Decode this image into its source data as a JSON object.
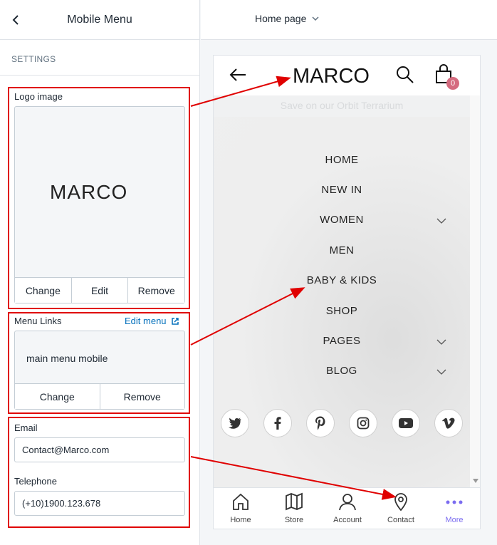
{
  "panel": {
    "title": "Mobile Menu",
    "settings_label": "SETTINGS"
  },
  "logo_section": {
    "label": "Logo image",
    "brand_text": "MARCO",
    "buttons": {
      "change": "Change",
      "edit": "Edit",
      "remove": "Remove"
    }
  },
  "menu_links": {
    "label": "Menu Links",
    "edit_link": "Edit menu",
    "menu_name": "main menu mobile",
    "buttons": {
      "change": "Change",
      "remove": "Remove"
    }
  },
  "email": {
    "label": "Email",
    "value": "Contact@Marco.com"
  },
  "telephone": {
    "label": "Telephone",
    "value": "(+10)1900.123.678"
  },
  "topbar": {
    "page_select": "Home page"
  },
  "preview": {
    "logo": "MARCO",
    "cart_count": "0",
    "promo": "Save        on our Orbit Terrarium",
    "menu_items": [
      {
        "label": "HOME"
      },
      {
        "label": "NEW IN"
      },
      {
        "label": "WOMEN"
      },
      {
        "label": "MEN"
      },
      {
        "label": "BABY & KIDS"
      },
      {
        "label": "SHOP"
      },
      {
        "label": "PAGES"
      },
      {
        "label": "BLOG"
      }
    ],
    "social": [
      "twitter-icon",
      "facebook-icon",
      "pinterest-icon",
      "instagram-icon",
      "youtube-icon",
      "vimeo-icon"
    ],
    "bottom_nav": [
      {
        "label": "Home",
        "icon": "home-icon"
      },
      {
        "label": "Store",
        "icon": "map-icon"
      },
      {
        "label": "Account",
        "icon": "user-icon"
      },
      {
        "label": "Contact",
        "icon": "location-pin-icon"
      },
      {
        "label": "More",
        "icon": "more-dots-icon"
      }
    ]
  },
  "colors": {
    "annotation_red": "#e00000",
    "link_blue": "#006fbb",
    "badge_pink": "#d56b7f",
    "more_purple": "#7b6cf0"
  }
}
